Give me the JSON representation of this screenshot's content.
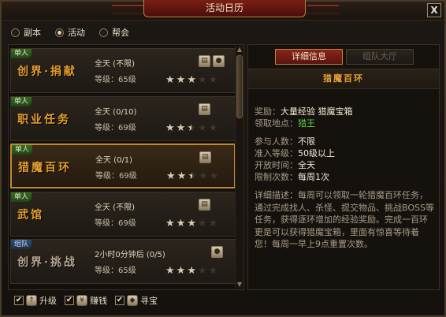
{
  "window": {
    "title": "活动日历",
    "close_label": "X"
  },
  "tabs_radio": [
    {
      "label": "副本",
      "selected": false
    },
    {
      "label": "活动",
      "selected": true
    },
    {
      "label": "帮会",
      "selected": false
    }
  ],
  "activities": [
    {
      "badge": "单人",
      "name": "创界·捐献",
      "time": "全天 (不限)",
      "level": "等级：65级",
      "stars": [
        1,
        1,
        1,
        0,
        0
      ],
      "icons": [
        "book-icon",
        "bag-icon"
      ],
      "grey": false,
      "selected": false
    },
    {
      "badge": "单人",
      "name": "职业任务",
      "time": "全天 (0/10)",
      "level": "等级：69级",
      "stars": [
        1,
        1,
        0.5,
        0,
        0
      ],
      "icons": [
        "book-icon"
      ],
      "grey": false,
      "selected": false
    },
    {
      "badge": "单人",
      "name": "猎魔百环",
      "time": "全天 (0/1)",
      "level": "等级：69级",
      "stars": [
        1,
        1,
        0.5,
        0,
        0
      ],
      "icons": [
        "book-icon"
      ],
      "grey": false,
      "selected": true
    },
    {
      "badge": "单人",
      "name": "武馆",
      "time": "全天 (不限)",
      "level": "等级：69级",
      "stars": [
        1,
        1,
        1,
        0,
        0
      ],
      "icons": [
        "book-icon"
      ],
      "grey": false,
      "selected": false
    },
    {
      "badge": "组队",
      "name": "创界·挑战",
      "time": "2小时0分钟后 (0/5)",
      "level": "等级：65级",
      "stars": [
        1,
        1,
        1,
        0,
        0
      ],
      "icons": [
        "bag-icon"
      ],
      "grey": true,
      "selected": false
    }
  ],
  "detail": {
    "tab_info": "详细信息",
    "tab_team": "组队大厅",
    "title": "猎魔百环",
    "reward_label": "奖励：",
    "reward_value": "大量经验  猎魔宝箱",
    "location_label": "领取地点：",
    "location_value": "猎王",
    "players_label": "参与人数：",
    "players_value": "不限",
    "level_label": "准入等级：",
    "level_value": "50级以上",
    "open_label": "开放时间：",
    "open_value": "全天",
    "limit_label": "限制次数：",
    "limit_value": "每周1次",
    "description": "详细描述：每周可以领取一轮猎魔百环任务，通过完成找人、杀怪、提交物品、挑战BOSS等任务，获得逐环增加的经验奖励。完成一百环更是可以获得猎魔宝箱，里面有惊喜等待着您！每周一早上9点重置次数。"
  },
  "filters": [
    {
      "label": "升级",
      "checked": true,
      "icon": "arrow-up-icon"
    },
    {
      "label": "赚钱",
      "checked": true,
      "icon": "money-bag-icon"
    },
    {
      "label": "寻宝",
      "checked": true,
      "icon": "treasure-icon"
    }
  ]
}
